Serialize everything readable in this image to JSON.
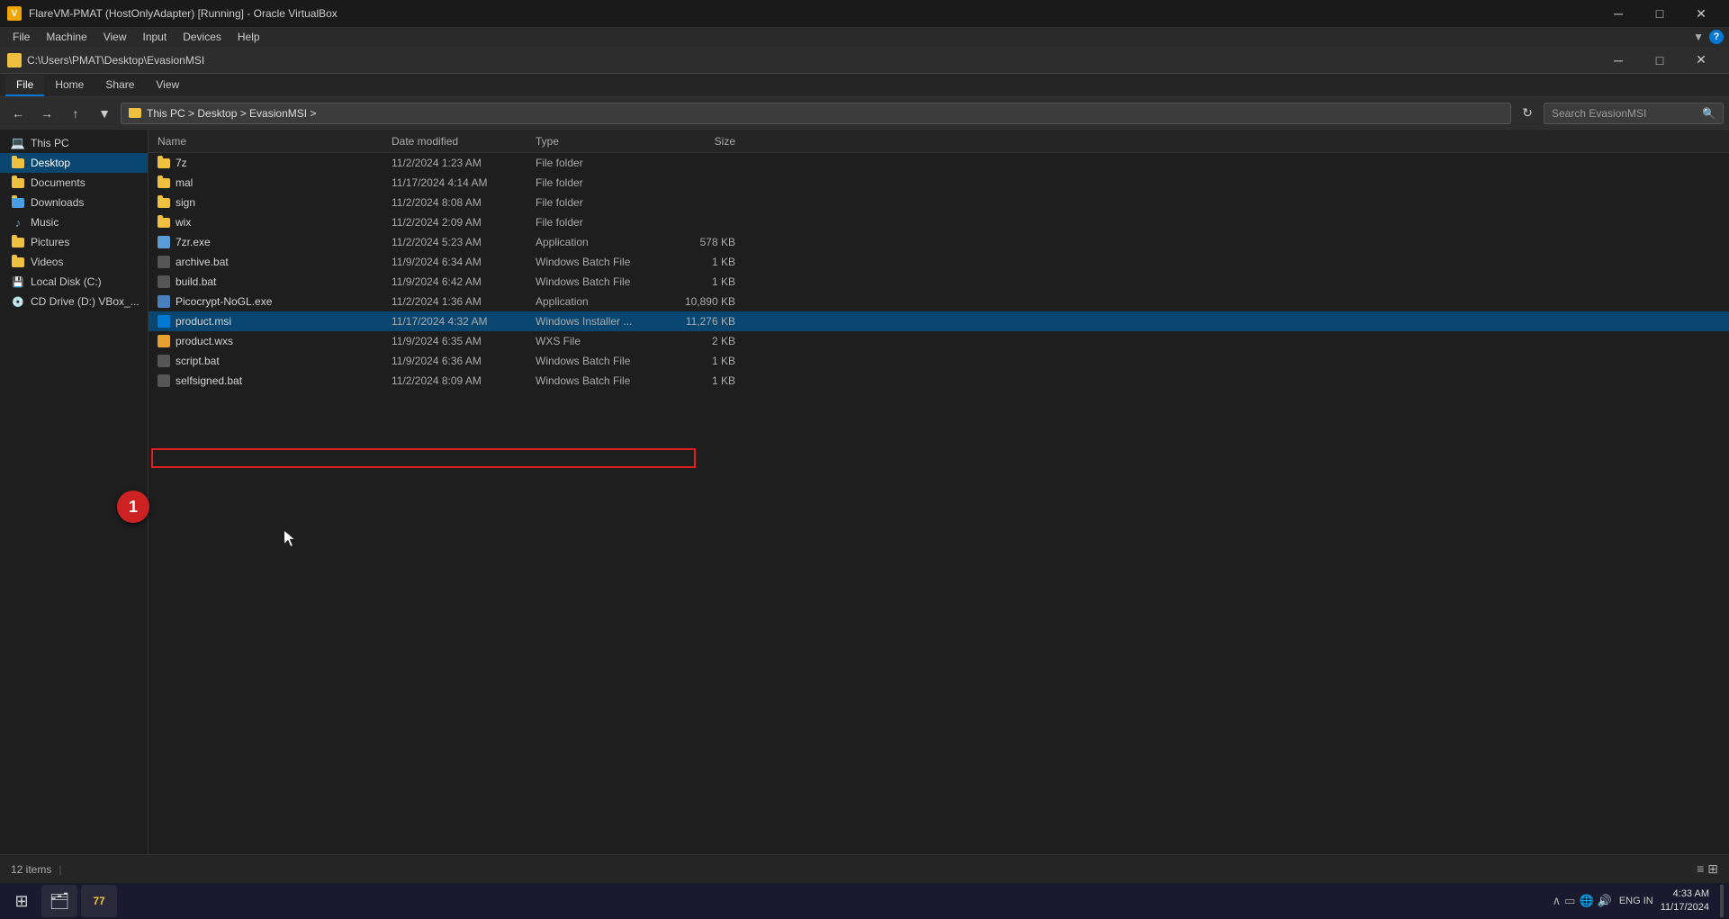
{
  "window": {
    "title": "FlareVM-PMAT (HostOnlyAdapter) [Running] - Oracle VirtualBox",
    "inner_title": "C:\\Users\\PMAT\\Desktop\\EvasionMSI"
  },
  "vbox_menu": {
    "items": [
      "File",
      "Machine",
      "View",
      "Input",
      "Devices",
      "Help"
    ]
  },
  "ribbon": {
    "tabs": [
      "File",
      "Home",
      "Share",
      "View"
    ]
  },
  "address_bar": {
    "path": "C:\\Users\\PMAT\\Desktop\\EvasionMSI",
    "breadcrumb": [
      "This PC",
      "Desktop",
      "EvasionMSI"
    ],
    "search_placeholder": "Search EvasionMSI"
  },
  "sidebar": {
    "items": [
      {
        "label": "This PC",
        "type": "computer"
      },
      {
        "label": "Desktop",
        "type": "folder",
        "active": true
      },
      {
        "label": "Documents",
        "type": "folder"
      },
      {
        "label": "Downloads",
        "type": "folder"
      },
      {
        "label": "Music",
        "type": "music"
      },
      {
        "label": "Pictures",
        "type": "folder"
      },
      {
        "label": "Videos",
        "type": "folder"
      },
      {
        "label": "Local Disk (C:)",
        "type": "disk"
      },
      {
        "label": "CD Drive (D:) VBox_...",
        "type": "disk"
      }
    ]
  },
  "files": {
    "columns": [
      "Name",
      "Date modified",
      "Type",
      "Size"
    ],
    "rows": [
      {
        "name": "7z",
        "date": "11/2/2024 1:23 AM",
        "type": "File folder",
        "size": "",
        "icon": "folder",
        "selected": false,
        "highlighted": false
      },
      {
        "name": "mal",
        "date": "11/17/2024 4:14 AM",
        "type": "File folder",
        "size": "",
        "icon": "folder",
        "selected": false,
        "highlighted": false
      },
      {
        "name": "sign",
        "date": "11/2/2024 8:08 AM",
        "type": "File folder",
        "size": "",
        "icon": "folder",
        "selected": false,
        "highlighted": false
      },
      {
        "name": "wix",
        "date": "11/2/2024 2:09 AM",
        "type": "File folder",
        "size": "",
        "icon": "folder",
        "selected": false,
        "highlighted": false
      },
      {
        "name": "7zr.exe",
        "date": "11/2/2024 5:23 AM",
        "type": "Application",
        "size": "578 KB",
        "icon": "exe",
        "selected": false,
        "highlighted": false
      },
      {
        "name": "archive.bat",
        "date": "11/9/2024 6:34 AM",
        "type": "Windows Batch File",
        "size": "1 KB",
        "icon": "bat",
        "selected": false,
        "highlighted": false
      },
      {
        "name": "build.bat",
        "date": "11/9/2024 6:42 AM",
        "type": "Windows Batch File",
        "size": "1 KB",
        "icon": "bat",
        "selected": false,
        "highlighted": false
      },
      {
        "name": "Picocrypt-NoGL.exe",
        "date": "11/2/2024 1:36 AM",
        "type": "Application",
        "size": "10,890 KB",
        "icon": "exe2",
        "selected": false,
        "highlighted": false
      },
      {
        "name": "product.msi",
        "date": "11/17/2024 4:32 AM",
        "type": "Windows Installer ...",
        "size": "11,276 KB",
        "icon": "msi",
        "selected": true,
        "highlighted": true
      },
      {
        "name": "product.wxs",
        "date": "11/9/2024 6:35 AM",
        "type": "WXS File",
        "size": "2 KB",
        "icon": "wxs",
        "selected": false,
        "highlighted": false
      },
      {
        "name": "script.bat",
        "date": "11/9/2024 6:36 AM",
        "type": "Windows Batch File",
        "size": "1 KB",
        "icon": "bat",
        "selected": false,
        "highlighted": false
      },
      {
        "name": "selfsigned.bat",
        "date": "11/2/2024 8:09 AM",
        "type": "Windows Batch File",
        "size": "1 KB",
        "icon": "bat",
        "selected": false,
        "highlighted": false
      }
    ]
  },
  "status_bar": {
    "text": "12 items",
    "divider": "|"
  },
  "taskbar": {
    "start_icon": "⊞",
    "apps": [
      "🗂",
      "77"
    ],
    "clock_time": "4:33 AM",
    "clock_date": "11/17/2024",
    "language": "ENG IN",
    "tray_icons": [
      "∧",
      "▭",
      "🌐",
      "🔊"
    ]
  },
  "step_badge": {
    "number": "1"
  },
  "colors": {
    "accent": "#0078d4",
    "red_highlight": "#e02020",
    "selected_row": "#094771",
    "folder_color": "#f0c040",
    "bg_dark": "#1e1e1e",
    "bg_mid": "#252525",
    "bg_light": "#2d2d2d"
  }
}
